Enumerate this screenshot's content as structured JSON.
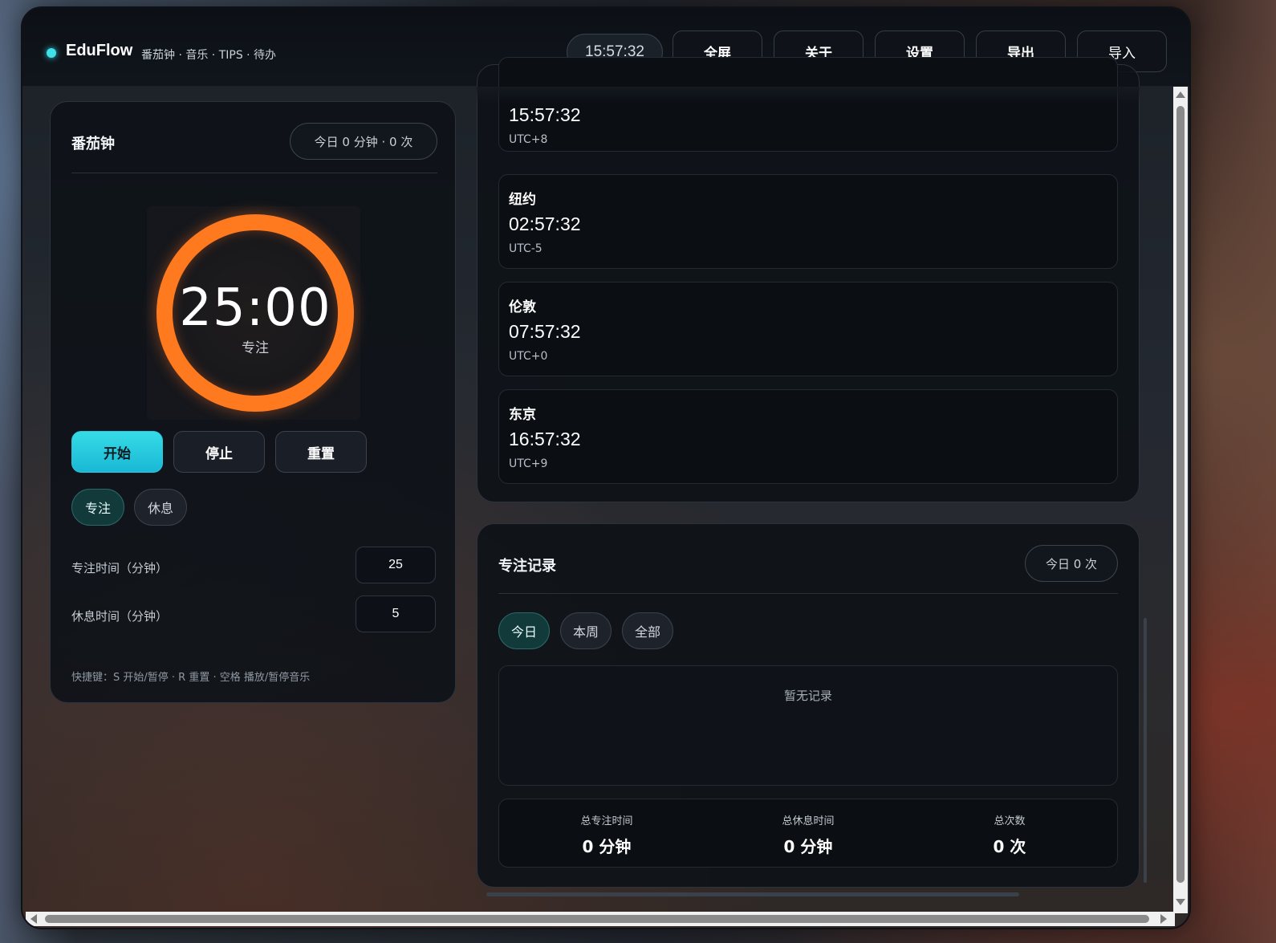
{
  "header": {
    "brand": "EduFlow",
    "subtitle": "番茄钟 · 音乐 · TIPS · 待办",
    "clock": "15:57:32",
    "buttons": {
      "fullscreen": "全屏",
      "about": "关于",
      "settings": "设置",
      "export": "导出",
      "import": "导入"
    }
  },
  "pomodoro": {
    "title": "番茄钟",
    "today_summary": "今日 0 分钟 · 0 次",
    "timer": "25:00",
    "timer_mode": "专注",
    "controls": {
      "start": "开始",
      "stop": "停止",
      "reset": "重置"
    },
    "modes": {
      "focus": "专注",
      "rest": "休息"
    },
    "focus_label": "专注时间（分钟）",
    "focus_value": "25",
    "rest_label": "休息时间（分钟）",
    "rest_value": "5",
    "shortcuts": "快捷键：S 开始/暂停 · R 重置 · 空格 播放/暂停音乐",
    "accent": "#ff7a1f"
  },
  "world_clock": {
    "cities": [
      {
        "name": "",
        "time": "15:57:32",
        "tz": "UTC+8"
      },
      {
        "name": "纽约",
        "time": "02:57:32",
        "tz": "UTC-5"
      },
      {
        "name": "伦敦",
        "time": "07:57:32",
        "tz": "UTC+0"
      },
      {
        "name": "东京",
        "time": "16:57:32",
        "tz": "UTC+9"
      }
    ]
  },
  "records": {
    "title": "专注记录",
    "badge": "今日 0 次",
    "tabs": {
      "today": "今日",
      "week": "本周",
      "all": "全部"
    },
    "empty": "暂无记录",
    "stats": [
      {
        "label": "总专注时间",
        "value": "0 分钟"
      },
      {
        "label": "总休息时间",
        "value": "0 分钟"
      },
      {
        "label": "总次数",
        "value": "0 次"
      }
    ]
  }
}
